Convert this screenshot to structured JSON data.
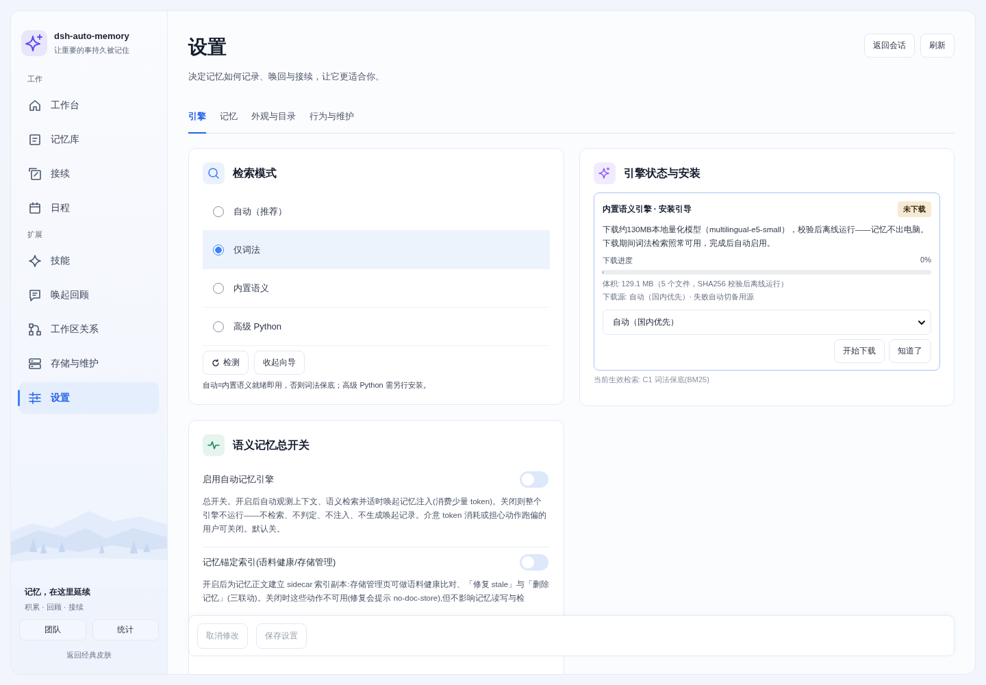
{
  "app": {
    "name": "dsh-auto-memory",
    "tagline": "让重要的事持久被记住"
  },
  "nav_sections": [
    {
      "label": "工作",
      "items": [
        {
          "label": "工作台",
          "selected": false
        },
        {
          "label": "记忆库",
          "selected": false
        },
        {
          "label": "接续",
          "selected": false
        },
        {
          "label": "日程",
          "selected": false
        }
      ]
    },
    {
      "label": "扩展",
      "items": [
        {
          "label": "技能",
          "selected": false
        },
        {
          "label": "唤起回顾",
          "selected": false
        },
        {
          "label": "工作区关系",
          "selected": false
        },
        {
          "label": "存储与维护",
          "selected": false
        },
        {
          "label": "设置",
          "selected": true
        }
      ]
    }
  ],
  "sidebar_footer": {
    "title": "记忆，在这里延续",
    "subtitle": "积累 · 回顾 · 接续",
    "buttons": [
      "团队",
      "统计"
    ],
    "link": "返回经典皮肤"
  },
  "header": {
    "title": "设置",
    "subtitle": "决定记忆如何记录、唤回与接续，让它更适合你。",
    "buttons": [
      "返回会话",
      "刷新"
    ]
  },
  "tabs": [
    {
      "label": "引擎",
      "selected": true
    },
    {
      "label": "记忆",
      "selected": false
    },
    {
      "label": "外观与目录",
      "selected": false
    },
    {
      "label": "行为与维护",
      "selected": false
    }
  ],
  "retrieval_card": {
    "title": "检索模式",
    "options": [
      {
        "label": "自动（推荐）",
        "selected": false
      },
      {
        "label": "仅词法",
        "selected": true
      },
      {
        "label": "内置语义",
        "selected": false
      },
      {
        "label": "高级 Python",
        "selected": false
      }
    ],
    "buttons": [
      {
        "label": "检测",
        "kind": "refresh"
      },
      {
        "label": "收起向导",
        "kind": "plain"
      }
    ],
    "note": "自动=内置语义就绪即用，否则词法保底；高级 Python 需另行安装。"
  },
  "engine_card": {
    "title": "引擎状态与安装",
    "guide": {
      "title": "内置语义引擎 · 安装引导",
      "badge": "未下载",
      "description": "下载约130MB本地量化模型（multilingual-e5-small），校验后离线运行——记忆不出电脑。下载期间词法检索照常可用，完成后自动启用。",
      "progress_label": "下载进度",
      "progress_reading": "0%",
      "level": 0,
      "size_info": "体积: 129.1 MB（5 个文件，SHA256 校验后离线运行）",
      "source_info": "下载源: 自动（国内优先）· 失败自动切备用源",
      "source_select": "自动（国内优先）",
      "buttons": [
        "开始下载",
        "知道了"
      ]
    },
    "footer": "当前生效检索: C1 词法保底(BM25)"
  },
  "semantic_card": {
    "title": "语义记忆总开关",
    "settings": [
      {
        "label": "启用自动记忆引擎",
        "on": false,
        "description": "总开关。开启后自动观测上下文、语义检索并适时唤起记忆注入(消费少量 token)。关闭则整个引擎不运行——不检索、不判定、不注入、不生成唤起记录。介意 token 消耗或担心动作跑偏的用户可关闭。默认关。"
      },
      {
        "label": "记忆锚定索引(语料健康/存储管理)",
        "on": false,
        "description": "开启后为记忆正文建立 sidecar 索引副本:存储管理页可做语料健康比对、「修复 stale」与「删除记忆」(三联动)。关闭时这些动作不可用(修复会提示 no-doc-store),但不影响记忆读写与检"
      }
    ]
  },
  "save_bar": {
    "buttons": [
      {
        "label": "取消修改",
        "disabled": true
      },
      {
        "label": "保存设置",
        "disabled": true
      }
    ]
  }
}
